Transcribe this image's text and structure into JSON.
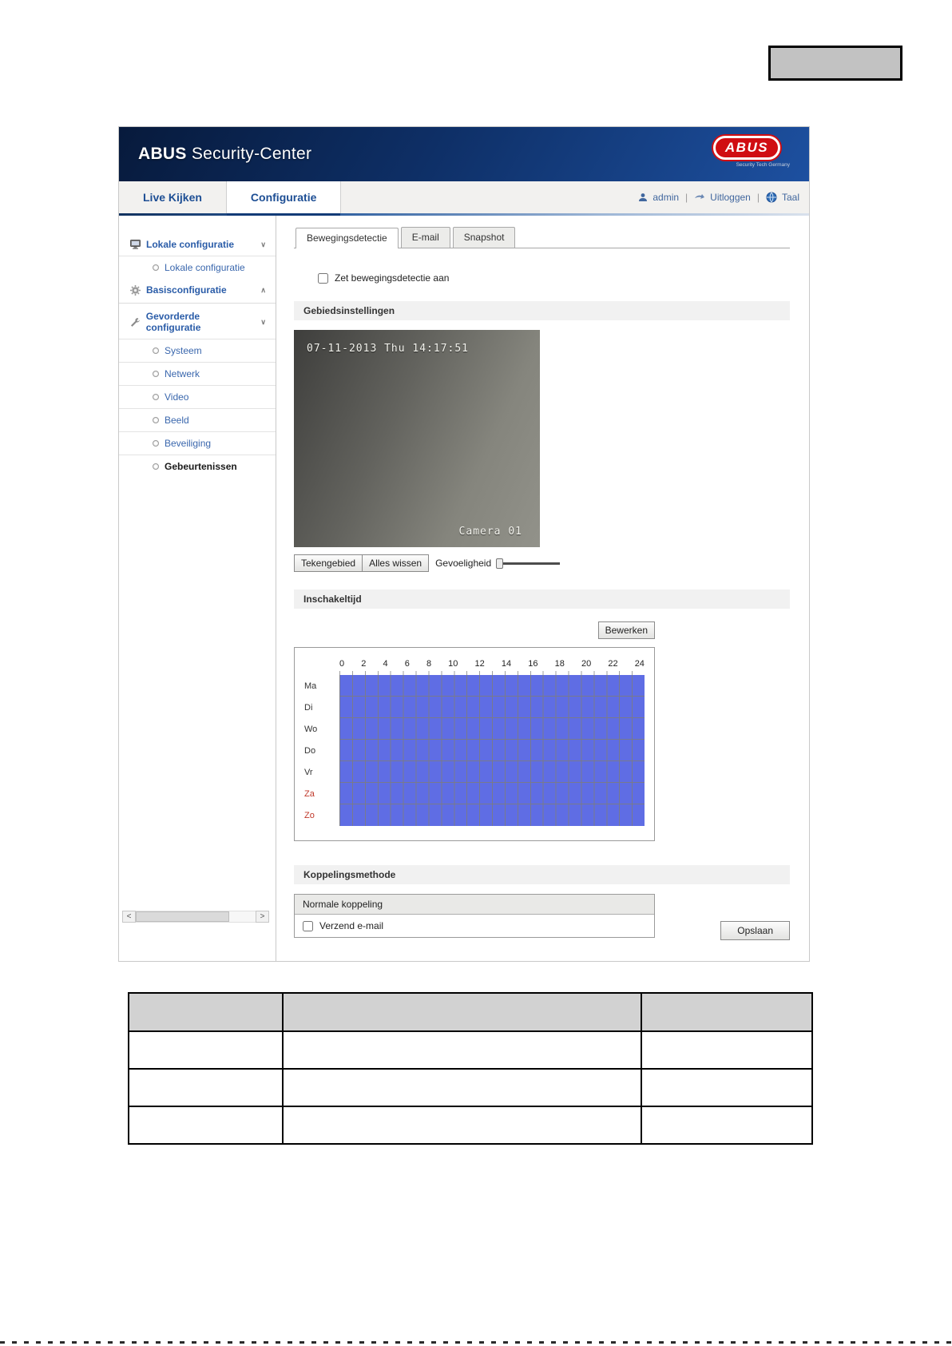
{
  "colors": {
    "grid_fill": "#5f6de4",
    "accent_blue": "#1d4e94",
    "logo_red": "#d00d12",
    "weekend_red": "#c0392b"
  },
  "header": {
    "brand_bold": "ABUS",
    "brand_rest": " Security-Center",
    "logo_text": "ABUS",
    "logo_subtext": "Security Tech Germany"
  },
  "nav": {
    "tab_live": "Live Kijken",
    "tab_config": "Configuratie",
    "user": "admin",
    "logout": "Uitloggen",
    "language": "Taal",
    "separator": "|"
  },
  "sidebar": {
    "group1": {
      "label": "Lokale configuratie",
      "chevron": "∨"
    },
    "group1_items": [
      {
        "label": "Lokale configuratie"
      }
    ],
    "group2": {
      "label": "Basisconfiguratie",
      "chevron": "∧"
    },
    "group3": {
      "label": "Gevorderde configuratie",
      "chevron": "∨"
    },
    "group3_items": [
      {
        "label": "Systeem"
      },
      {
        "label": "Netwerk"
      },
      {
        "label": "Video"
      },
      {
        "label": "Beeld"
      },
      {
        "label": "Beveiliging"
      },
      {
        "label": "Gebeurtenissen"
      }
    ],
    "scroll_left": "<",
    "scroll_right": ">"
  },
  "tabs": {
    "t0": "Bewegingsdetectie",
    "t1": "E-mail",
    "t2": "Snapshot"
  },
  "motion": {
    "enable_label": "Zet bewegingsdetectie aan",
    "enabled": false
  },
  "sections": {
    "area": "Gebiedsinstellingen",
    "schedule": "Inschakeltijd",
    "linkage": "Koppelingsmethode"
  },
  "video": {
    "timestamp": "07-11-2013 Thu 14:17:51",
    "camera": "Camera 01"
  },
  "area_tools": {
    "draw": "Tekengebied",
    "clear": "Alles wissen",
    "sensitivity": "Gevoeligheid",
    "sensitivity_value": 0
  },
  "schedule": {
    "edit": "Bewerken",
    "hours": [
      "0",
      "2",
      "4",
      "6",
      "8",
      "10",
      "12",
      "14",
      "16",
      "18",
      "20",
      "22",
      "24"
    ],
    "days": [
      {
        "label": "Ma",
        "weekend": false
      },
      {
        "label": "Di",
        "weekend": false
      },
      {
        "label": "Wo",
        "weekend": false
      },
      {
        "label": "Do",
        "weekend": false
      },
      {
        "label": "Vr",
        "weekend": false
      },
      {
        "label": "Za",
        "weekend": true
      },
      {
        "label": "Zo",
        "weekend": true
      }
    ],
    "all_selected": true
  },
  "linkage": {
    "header": "Normale koppeling",
    "email": {
      "label": "Verzend e-mail",
      "checked": false
    }
  },
  "save_label": "Opslaan",
  "bottom_table": {
    "header": [
      "",
      "",
      ""
    ],
    "rows": [
      [
        "",
        "",
        ""
      ],
      [
        "",
        "",
        ""
      ],
      [
        "",
        "",
        ""
      ]
    ]
  }
}
